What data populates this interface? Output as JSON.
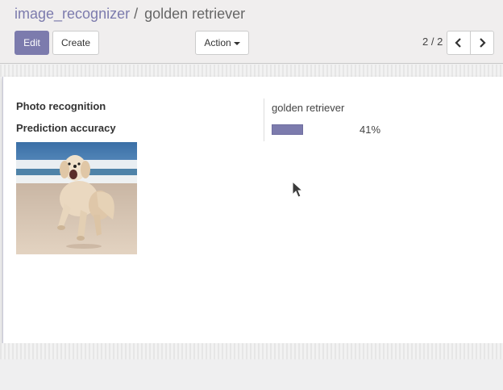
{
  "breadcrumb": {
    "parent": "image_recognizer",
    "separator": "/",
    "current": "golden retriever"
  },
  "toolbar": {
    "edit_label": "Edit",
    "create_label": "Create",
    "action_label": "Action"
  },
  "pager": {
    "value": "2 / 2"
  },
  "form": {
    "photo_label": "Photo recognition",
    "accuracy_label": "Prediction accuracy",
    "prediction_value": "golden retriever",
    "accuracy_percent": 41,
    "accuracy_text": "41%",
    "photo_alt": "golden retriever photo"
  },
  "colors": {
    "primary": "#7c7bad",
    "breadcrumb_link": "#7c7bad"
  },
  "icons": {
    "pager_prev": "chevron-left-icon",
    "pager_next": "chevron-right-icon",
    "action_caret": "caret-down-icon"
  }
}
